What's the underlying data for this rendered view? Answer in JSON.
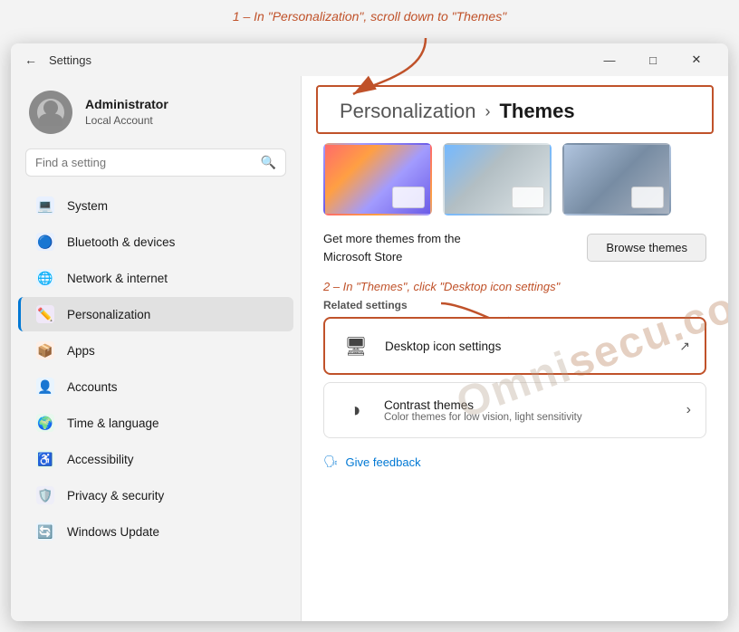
{
  "page": {
    "instruction1": "1 – In \"Personalization\", scroll down to \"Themes\"",
    "instruction2": "2 – In \"Themes\", click \"Desktop icon settings\""
  },
  "titlebar": {
    "title": "Settings",
    "back_label": "←",
    "minimize_label": "—",
    "maximize_label": "□",
    "close_label": "✕"
  },
  "user": {
    "name": "Administrator",
    "role": "Local Account"
  },
  "search": {
    "placeholder": "Find a setting"
  },
  "nav": {
    "items": [
      {
        "id": "system",
        "label": "System",
        "icon": "🖥️",
        "color": "#0078d4"
      },
      {
        "id": "bluetooth",
        "label": "Bluetooth & devices",
        "icon": "🔵",
        "color": "#0078d4"
      },
      {
        "id": "network",
        "label": "Network & internet",
        "icon": "🌐",
        "color": "#0078d4"
      },
      {
        "id": "personalization",
        "label": "Personalization",
        "icon": "🎨",
        "active": true
      },
      {
        "id": "apps",
        "label": "Apps",
        "icon": "📦",
        "color": "#555"
      },
      {
        "id": "accounts",
        "label": "Accounts",
        "icon": "👤",
        "color": "#0078d4"
      },
      {
        "id": "time",
        "label": "Time & language",
        "icon": "🌍",
        "color": "#0078d4"
      },
      {
        "id": "accessibility",
        "label": "Accessibility",
        "icon": "♿",
        "color": "#0078d4"
      },
      {
        "id": "privacy",
        "label": "Privacy & security",
        "icon": "🛡️",
        "color": "#555"
      },
      {
        "id": "windows-update",
        "label": "Windows Update",
        "icon": "🔄",
        "color": "#0078d4"
      }
    ]
  },
  "breadcrumb": {
    "part1": "Personalization",
    "separator": "›",
    "part2": "Themes"
  },
  "ms_store": {
    "text": "Get more themes from the\nMicrosoft Store",
    "button": "Browse themes"
  },
  "related_settings": {
    "label": "Related settings",
    "items": [
      {
        "id": "desktop-icon",
        "icon": "🖥",
        "title": "Desktop icon settings",
        "type": "external",
        "highlighted": true
      },
      {
        "id": "contrast-themes",
        "icon": "◑",
        "title": "Contrast themes",
        "description": "Color themes for low vision, light sensitivity",
        "type": "chevron"
      }
    ]
  },
  "feedback": {
    "label": "Give feedback",
    "icon": "🗣"
  }
}
